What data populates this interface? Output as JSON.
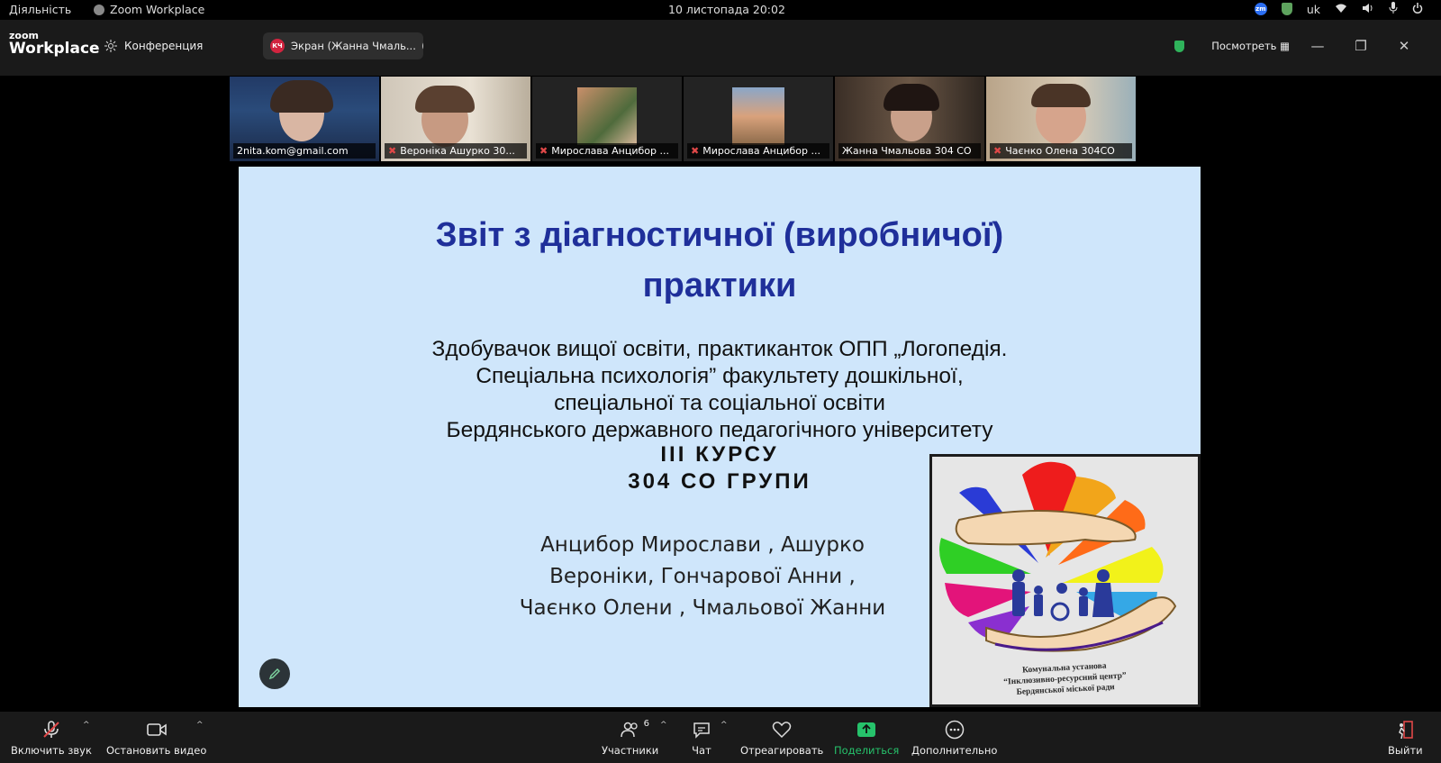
{
  "system": {
    "activities": "Діяльність",
    "app_name": "Zoom Workplace",
    "clock": "10 листопада  20:02",
    "lang": "uk"
  },
  "header": {
    "logo_line1": "zoom",
    "logo_line2": "Workplace",
    "conference_label": "Конференция",
    "screen_share_label": "Экран (Жанна Чмаль...",
    "view_label": "Посмотреть"
  },
  "participants": [
    {
      "name": "2nita.kom@gmail.com",
      "muted": false,
      "active": true
    },
    {
      "name": "Вероніка Ашурко 30...",
      "muted": true,
      "active": false
    },
    {
      "name": "Мирослава Анцибор ...",
      "muted": true,
      "active": false
    },
    {
      "name": "Мирослава Анцибор ...",
      "muted": true,
      "active": false
    },
    {
      "name": "Жанна Чмальова 304 СО",
      "muted": false,
      "active": false
    },
    {
      "name": "Чаєнко Олена 304СО",
      "muted": true,
      "active": false
    }
  ],
  "slide": {
    "title_line1": "Звіт з діагностичної (виробничої)",
    "title_line2": "практики",
    "sub_line1": "Здобувачок вищої освіти, практиканток ОПП „Логопедія.",
    "sub_line2": "Спеціальна психологія” факультету дошкільної,",
    "sub_line3": "спеціальної та соціальної освіти",
    "sub_line4": "Бердянського державного педагогічного університету",
    "course_line1": "ІІІ КУРСУ",
    "course_line2": "304 СО ГРУПИ",
    "names_line1": "Анцибор Мирослави , Ашурко",
    "names_line2": "Вероніки, Гончарової Анни ,",
    "names_line3": "Чаєнко Олени , Чмальової Жанни",
    "logo_text1": "Комунальна установа",
    "logo_text2": "“Інклюзивно-ресурсний центр”",
    "logo_text3": "Бердянської міської ради"
  },
  "toolbar": {
    "unmute": "Включить звук",
    "stop_video": "Остановить видео",
    "participants": "Участники",
    "participants_count": "6",
    "chat": "Чат",
    "react": "Отреагировать",
    "share": "Поделиться",
    "more": "Дополнительно",
    "leave": "Выйти"
  },
  "colors": {
    "slide_bg": "#cfe6fb",
    "title": "#1f2f9a",
    "share_green": "#26c26b",
    "active_outline": "#2ecc71"
  }
}
